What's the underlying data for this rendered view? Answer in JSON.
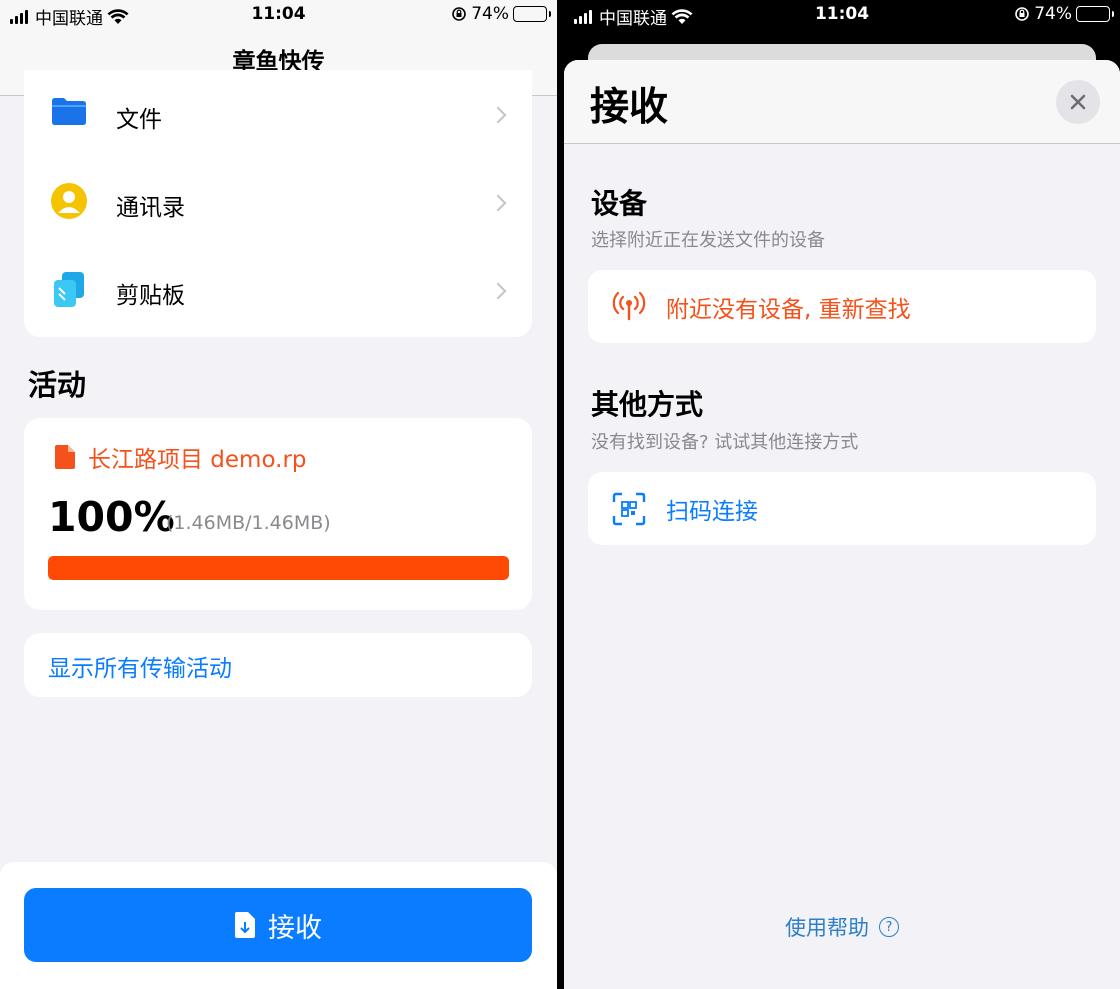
{
  "status_left": {
    "carrier": "中国联通",
    "time": "11:04",
    "battery": "74%"
  },
  "status_right": {
    "carrier": "中国联通",
    "time": "11:04",
    "battery": "74%"
  },
  "left": {
    "nav_title": "章鱼快传",
    "menu": [
      {
        "label": "文件",
        "icon": "folder-icon"
      },
      {
        "label": "通讯录",
        "icon": "contact-icon"
      },
      {
        "label": "剪贴板",
        "icon": "clipboard-icon"
      }
    ],
    "activity_title": "活动",
    "activity": {
      "file_name": "长江路项目 demo.rp",
      "percent_text": "100%",
      "size_text": "(1.46MB/1.46MB)",
      "progress": 1.0
    },
    "show_all": "显示所有传输活动",
    "receive_button": "接收"
  },
  "right": {
    "title": "接收",
    "devices": {
      "heading": "设备",
      "subtitle": "选择附近正在发送文件的设备",
      "empty_text": "附近没有设备, 重新查找"
    },
    "other": {
      "heading": "其他方式",
      "subtitle": "没有找到设备? 试试其他连接方式",
      "scan_text": "扫码连接"
    },
    "help": "使用帮助"
  },
  "colors": {
    "accent": "#0a7cff",
    "orange": "#f5511b",
    "progress": "#ff4a05"
  }
}
